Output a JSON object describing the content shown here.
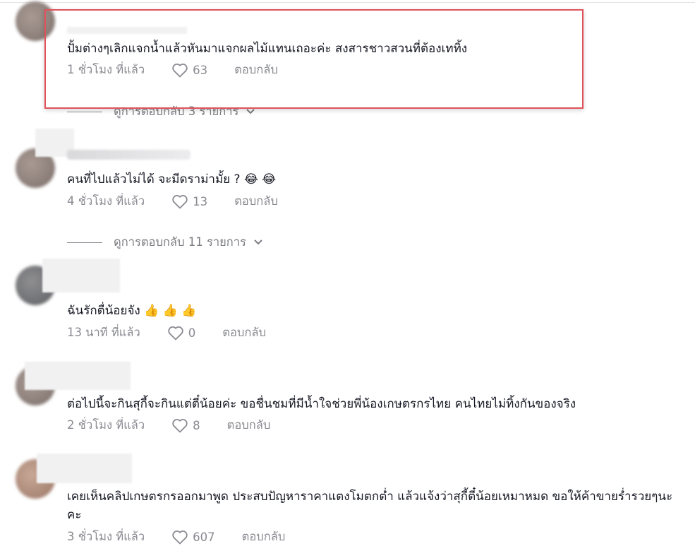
{
  "comments": [
    {
      "text": "ปั้มต่างๆเลิกแจกน้ำแล้วหันมาแจกผลไม้แทนเถอะค่ะ สงสารชาวสวนที่ต้องเททิ้ง",
      "time": "1 ชั่วโมง ที่แล้ว",
      "likes": "63",
      "reply": "ตอบกลับ",
      "view_replies": "ดูการตอบกลับ 3 รายการ"
    },
    {
      "text": "คนที่ไปแล้วไม่ได้ จะมีดราม่ามั้ย ? 😂 😂",
      "time": "4 ชั่วโมง ที่แล้ว",
      "likes": "13",
      "reply": "ตอบกลับ",
      "view_replies": "ดูการตอบกลับ 11 รายการ"
    },
    {
      "text": "ฉันรักตื่น้อยจัง 👍 👍 👍",
      "time": "13 นาที ที่แล้ว",
      "likes": "0",
      "reply": "ตอบกลับ"
    },
    {
      "text": "ต่อไปนี้จะกินสุกี้จะกินแต่ตี๋น้อยค่ะ ขอชื่นชมที่มีน้ำใจช่วยพี่น้องเกษตรกรไทย คนไทยไม่ทิ้งกันของจริง",
      "time": "2 ชั่วโมง ที่แล้ว",
      "likes": "8",
      "reply": "ตอบกลับ"
    },
    {
      "text": "เคยเห็นคลิปเกษตรกรออกมาพูด ประสบปัญหาราคาแตงโมตกต่ำ แล้วแจ้งว่าสุกี้ตี๋น้อยเหมาหมด ขอให้ค้าขายร่ำรวยๆนะคะ",
      "time": "3 ชั่วโมง ที่แล้ว",
      "likes": "607",
      "reply": "ตอบกลับ"
    }
  ],
  "icons": {
    "like": "heart-outline-icon",
    "expand": "chevron-down-icon"
  },
  "colors": {
    "highlight": "#e0535a",
    "meta": "#8a8b91"
  }
}
